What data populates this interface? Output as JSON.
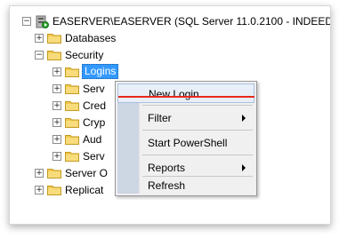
{
  "tree": {
    "root_label": "EASERVER\\EASERVER (SQL Server 11.0.2100 - INDEED",
    "items": [
      {
        "label": "Databases",
        "expander": "+"
      },
      {
        "label": "Security",
        "expander": "−"
      },
      {
        "label": "Logins",
        "expander": "+"
      },
      {
        "label": "Serv",
        "expander": "+"
      },
      {
        "label": "Cred",
        "expander": "+"
      },
      {
        "label": "Cryp",
        "expander": "+"
      },
      {
        "label": "Aud",
        "expander": "+"
      },
      {
        "label": "Serv",
        "expander": "+"
      },
      {
        "label": "Server O",
        "expander": "+"
      },
      {
        "label": "Replicat",
        "expander": "+"
      }
    ],
    "root_expander": "−"
  },
  "context_menu": {
    "items": [
      {
        "label": "New Login..."
      },
      {
        "label": "Filter"
      },
      {
        "label": "Start PowerShell"
      },
      {
        "label": "Reports"
      },
      {
        "label": "Refresh"
      }
    ]
  },
  "colors": {
    "selection": "#3399ff",
    "highlight_underline": "#e8291c",
    "folder_yellow": "#f3c94d"
  }
}
